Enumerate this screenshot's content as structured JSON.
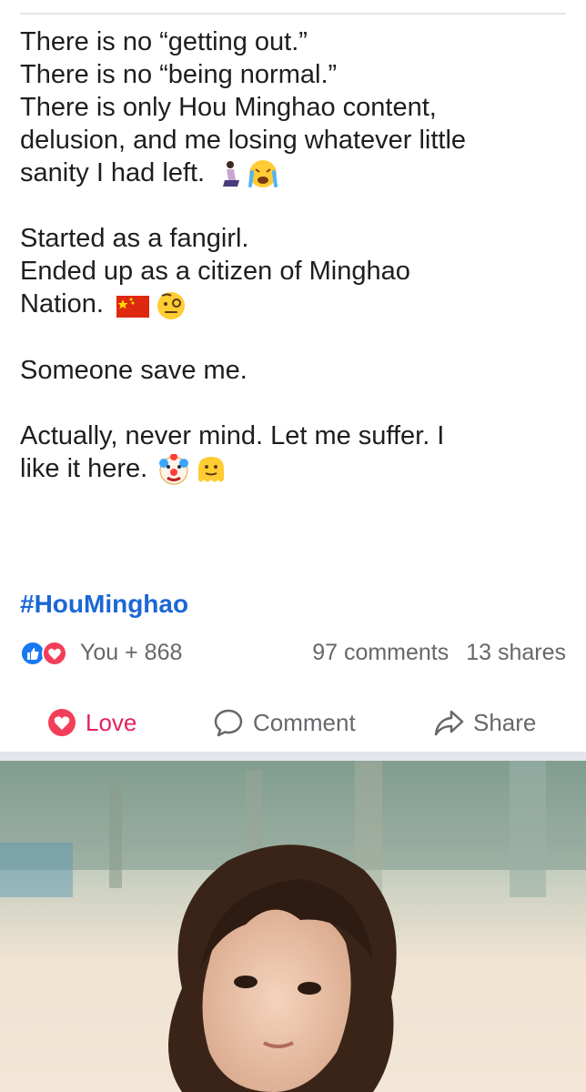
{
  "post": {
    "lines": [
      "There is no “getting out.”",
      "There is no “being normal.”",
      "There is only Hou Minghao content,",
      "delusion, and me losing whatever little",
      "sanity I had left.",
      "",
      "Started as a fangirl.",
      "Ended up as a citizen of Minghao",
      "Nation.",
      "",
      "Someone save me.",
      "",
      "Actually, never mind. Let me suffer. I",
      "like it here."
    ],
    "hashtag": "#HouMinghao"
  },
  "stats": {
    "reactions": "You + 868",
    "comments": "97 comments",
    "shares": "13 shares"
  },
  "actions": {
    "love": "Love",
    "comment": "Comment",
    "share": "Share"
  },
  "icons": {
    "like": "like-icon",
    "love": "heart-icon",
    "comment": "comment-icon",
    "share": "share-icon"
  },
  "colors": {
    "hashtag": "#1b67d4",
    "love": "#e0245e",
    "like": "#1877f2",
    "muted": "#65676b"
  }
}
